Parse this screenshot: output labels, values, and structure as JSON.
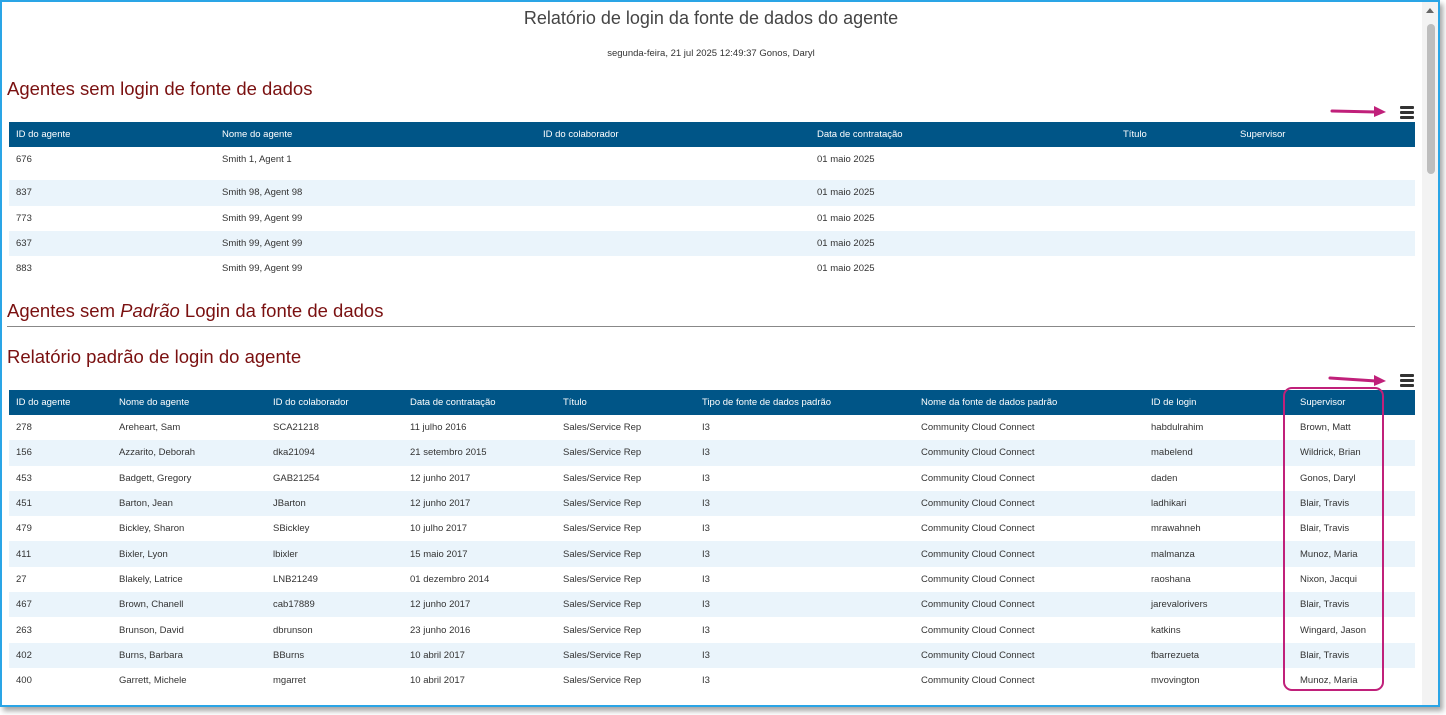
{
  "report": {
    "title": "Relatório de login da fonte de dados do agente",
    "meta": "segunda-feira, 21 jul 2025 12:49:37  Gonos, Daryl"
  },
  "section1": {
    "title": "Agentes sem login de fonte de dados",
    "columns": [
      "ID do agente",
      "Nome do agente",
      "ID do colaborador",
      "Data de contratação",
      "Título",
      "Supervisor"
    ],
    "rows": [
      [
        "676",
        "Smith 1, Agent 1",
        "",
        "01 maio 2025",
        "",
        ""
      ],
      [
        "837",
        "Smith 98, Agent 98",
        "",
        "01 maio 2025",
        "",
        ""
      ],
      [
        "773",
        "Smith 99, Agent 99",
        "",
        "01 maio 2025",
        "",
        ""
      ],
      [
        "637",
        "Smith 99, Agent 99",
        "",
        "01 maio 2025",
        "",
        ""
      ],
      [
        "883",
        "Smith 99, Agent 99",
        "",
        "01 maio 2025",
        "",
        ""
      ]
    ]
  },
  "section2": {
    "title_pre": "Agentes sem ",
    "title_em": "Padrão",
    "title_post": " Login da fonte de dados"
  },
  "section3": {
    "title": "Relatório padrão de login do agente",
    "columns": [
      "ID do agente",
      "Nome do agente",
      "ID do colaborador",
      "Data de contratação",
      "Título",
      "Tipo de fonte de dados padrão",
      "Nome da fonte de dados padrão",
      "ID de login",
      "Supervisor"
    ],
    "rows": [
      [
        "278",
        "Areheart, Sam",
        "SCA21218",
        "11 julho 2016",
        "Sales/Service Rep",
        "I3",
        "Community Cloud Connect",
        "habdulrahim",
        "Brown, Matt"
      ],
      [
        "156",
        "Azzarito, Deborah",
        "dka21094",
        "21 setembro 2015",
        "Sales/Service Rep",
        "I3",
        "Community Cloud Connect",
        "mabelend",
        "Wildrick, Brian"
      ],
      [
        "453",
        "Badgett, Gregory",
        "GAB21254",
        "12 junho 2017",
        "Sales/Service Rep",
        "I3",
        "Community Cloud Connect",
        "daden",
        "Gonos, Daryl"
      ],
      [
        "451",
        "Barton, Jean",
        "JBarton",
        "12 junho 2017",
        "Sales/Service Rep",
        "I3",
        "Community Cloud Connect",
        "ladhikari",
        "Blair, Travis"
      ],
      [
        "479",
        "Bickley, Sharon",
        "SBickley",
        "10 julho 2017",
        "Sales/Service Rep",
        "I3",
        "Community Cloud Connect",
        "mrawahneh",
        "Blair, Travis"
      ],
      [
        "411",
        "Bixler, Lyon",
        "lbixler",
        "15 maio 2017",
        "Sales/Service Rep",
        "I3",
        "Community Cloud Connect",
        "malmanza",
        "Munoz, Maria"
      ],
      [
        "27",
        "Blakely, Latrice",
        "LNB21249",
        "01 dezembro 2014",
        "Sales/Service Rep",
        "I3",
        "Community Cloud Connect",
        "raoshana",
        "Nixon, Jacqui"
      ],
      [
        "467",
        "Brown, Chanell",
        "cab17889",
        "12 junho 2017",
        "Sales/Service Rep",
        "I3",
        "Community Cloud Connect",
        "jarevalorivers",
        "Blair, Travis"
      ],
      [
        "263",
        "Brunson, David",
        "dbrunson",
        "23 junho 2016",
        "Sales/Service Rep",
        "I3",
        "Community Cloud Connect",
        "katkins",
        "Wingard, Jason"
      ],
      [
        "402",
        "Burns, Barbara",
        "BBurns",
        "10 abril 2017",
        "Sales/Service Rep",
        "I3",
        "Community Cloud Connect",
        "fbarrezueta",
        "Blair, Travis"
      ],
      [
        "400",
        "Garrett, Michele",
        "mgarret",
        "10 abril 2017",
        "Sales/Service Rep",
        "I3",
        "Community Cloud Connect",
        "mvovington",
        "Munoz, Maria"
      ]
    ]
  },
  "icons": {
    "menu": "hamburger-menu-icon",
    "annotation": "arrow-annotation-icon"
  },
  "colors": {
    "header": "#005587",
    "section_title": "#7a1010",
    "highlight": "#c0207a",
    "row_alt": "#eaf4fb"
  }
}
